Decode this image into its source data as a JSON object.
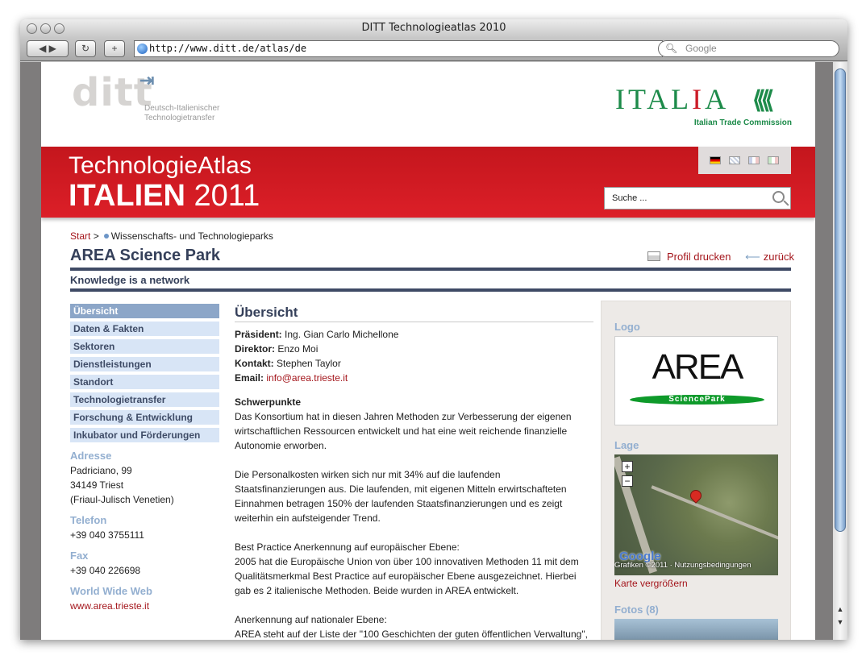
{
  "browser": {
    "title": "DITT Technologieatlas 2010",
    "url": "http://www.ditt.de/atlas/de",
    "search_placeholder": "Google",
    "reload_icon": "reload-icon",
    "add_icon": "add-bookmark-icon"
  },
  "header": {
    "ditt_word": "ditt",
    "ditt_sub1": "Deutsch-Italienischer",
    "ditt_sub2": "Technologietransfer",
    "italia_a": "ITAL",
    "italia_b": "I",
    "italia_c": "A",
    "italia_sub": "Italian Trade Commission",
    "band_line1": "TechnologieAtlas",
    "band_line2a": "ITALIEN",
    "band_line2b": " 2011",
    "search_placeholder": "Suche ...",
    "flags": [
      "German flag",
      "English flag",
      "French flag",
      "Italian flag"
    ]
  },
  "breadcrumb": {
    "start": "Start",
    "sep": ">",
    "current": "Wissenschafts- und Technologieparks"
  },
  "profile": {
    "title": "AREA Science Park",
    "print": "Profil drucken",
    "back": "zurück",
    "tagline": "Knowledge is a network"
  },
  "nav": [
    {
      "label": "Übersicht",
      "active": true
    },
    {
      "label": "Daten & Fakten",
      "active": false
    },
    {
      "label": "Sektoren",
      "active": false
    },
    {
      "label": "Dienstleistungen",
      "active": false
    },
    {
      "label": "Standort",
      "active": false
    },
    {
      "label": "Technologietransfer",
      "active": false
    },
    {
      "label": "Forschung & Entwicklung",
      "active": false
    },
    {
      "label": "Inkubator und Förderungen",
      "active": false
    }
  ],
  "contact": {
    "adresse_h": "Adresse",
    "adresse_1": "Padriciano, 99",
    "adresse_2": "34149 Triest",
    "adresse_3": "(Friaul-Julisch Venetien)",
    "telefon_h": "Telefon",
    "telefon": "+39 040 3755111",
    "fax_h": "Fax",
    "fax": "+39 040 226698",
    "web_h": "World Wide Web",
    "web": "www.area.trieste.it"
  },
  "main": {
    "heading": "Übersicht",
    "praesident_k": "Präsident:",
    "praesident_v": " Ing. Gian Carlo Michellone",
    "direktor_k": "Direktor:",
    "direktor_v": " Enzo Moi",
    "kontakt_k": "Kontakt:",
    "kontakt_v": " Stephen Taylor",
    "email_k": "Email:",
    "email_v": "info@area.trieste.it",
    "schwerpunkte": "Schwerpunkte",
    "p1": "Das Konsortium hat in diesen Jahren Methoden zur Verbesserung der eigenen wirtschaftlichen Ressourcen entwickelt und hat eine weit reichende finanzielle Autonomie erworben.",
    "p2": "Die Personalkosten wirken sich nur mit 34% auf die laufenden Staatsfinanzierungen aus. Die laufenden, mit eigenen Mitteln erwirtschafteten Einnahmen betragen 150% der laufenden Staatsfinanzierungen und es zeigt weiterhin ein aufsteigender Trend.",
    "p3a": "Best Practice Anerkennung auf europäischer Ebene:",
    "p3b": "2005 hat die Europäische Union von über 100 innovativen Methoden 11 mit dem Qualitätsmerkmal Best Practice auf europäischer Ebene ausgezeichnet. Hierbei gab es 2 italienische Methoden. Beide wurden in AREA entwickelt.",
    "p4a": "Anerkennung auf nationaler Ebene:",
    "p4b": "AREA steht auf der Liste der \"100 Geschichten der guten öffentlichen Verwaltung\","
  },
  "right": {
    "logo_h": "Logo",
    "logo_text": "AREA",
    "logo_band": "SciencePark",
    "lage_h": "Lage",
    "map_google": "Google",
    "map_credit": "Grafiken ©2011 · Nutzungsbedingungen",
    "map_link": "Karte vergrößern",
    "fotos_h": "Fotos (8)"
  }
}
